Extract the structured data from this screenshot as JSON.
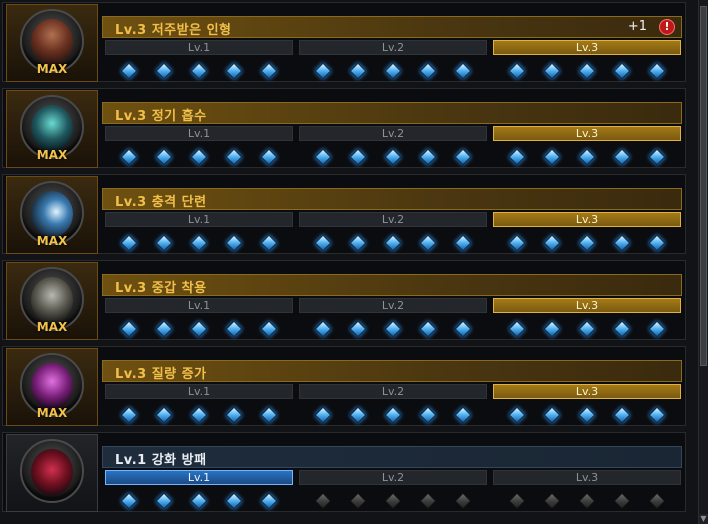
{
  "level_names": [
    "Lv.1",
    "Lv.2",
    "Lv.3"
  ],
  "rows": [
    {
      "title": "Lv.3 저주받은 인형",
      "badge": "MAX",
      "portrait": "cursed-doll-portrait",
      "bonus": "+1",
      "alert": "!",
      "levels": [
        {
          "label": "Lv.1",
          "state": "default",
          "gems": 5,
          "unlocked": true
        },
        {
          "label": "Lv.2",
          "state": "default",
          "gems": 5,
          "unlocked": true
        },
        {
          "label": "Lv.3",
          "state": "done",
          "gems": 5,
          "unlocked": true
        }
      ]
    },
    {
      "title": "Lv.3 정기 흡수",
      "badge": "MAX",
      "portrait": "vitality-absorb-portrait",
      "levels": [
        {
          "label": "Lv.1",
          "state": "default",
          "gems": 5,
          "unlocked": true
        },
        {
          "label": "Lv.2",
          "state": "default",
          "gems": 5,
          "unlocked": true
        },
        {
          "label": "Lv.3",
          "state": "done",
          "gems": 5,
          "unlocked": true
        }
      ]
    },
    {
      "title": "Lv.3 충격 단련",
      "badge": "MAX",
      "portrait": "shock-training-portrait",
      "levels": [
        {
          "label": "Lv.1",
          "state": "default",
          "gems": 5,
          "unlocked": true
        },
        {
          "label": "Lv.2",
          "state": "default",
          "gems": 5,
          "unlocked": true
        },
        {
          "label": "Lv.3",
          "state": "done",
          "gems": 5,
          "unlocked": true
        }
      ]
    },
    {
      "title": "Lv.3 중갑 착용",
      "badge": "MAX",
      "portrait": "heavy-armor-portrait",
      "levels": [
        {
          "label": "Lv.1",
          "state": "default",
          "gems": 5,
          "unlocked": true
        },
        {
          "label": "Lv.2",
          "state": "default",
          "gems": 5,
          "unlocked": true
        },
        {
          "label": "Lv.3",
          "state": "done",
          "gems": 5,
          "unlocked": true
        }
      ]
    },
    {
      "title": "Lv.3 질량 증가",
      "badge": "MAX",
      "portrait": "mass-increase-portrait",
      "levels": [
        {
          "label": "Lv.1",
          "state": "default",
          "gems": 5,
          "unlocked": true
        },
        {
          "label": "Lv.2",
          "state": "default",
          "gems": 5,
          "unlocked": true
        },
        {
          "label": "Lv.3",
          "state": "done",
          "gems": 5,
          "unlocked": true
        }
      ]
    },
    {
      "title": "Lv.1 강화 방패",
      "badge": "",
      "portrait": "reinforced-shield-portrait",
      "levels": [
        {
          "label": "Lv.1",
          "state": "active",
          "gems": 5,
          "unlocked": true
        },
        {
          "label": "Lv.2",
          "state": "default",
          "gems": 5,
          "unlocked": false
        },
        {
          "label": "Lv.3",
          "state": "default",
          "gems": 5,
          "unlocked": false
        }
      ]
    }
  ],
  "scrollbar": {
    "down_arrow_icon": "triangle-down"
  }
}
